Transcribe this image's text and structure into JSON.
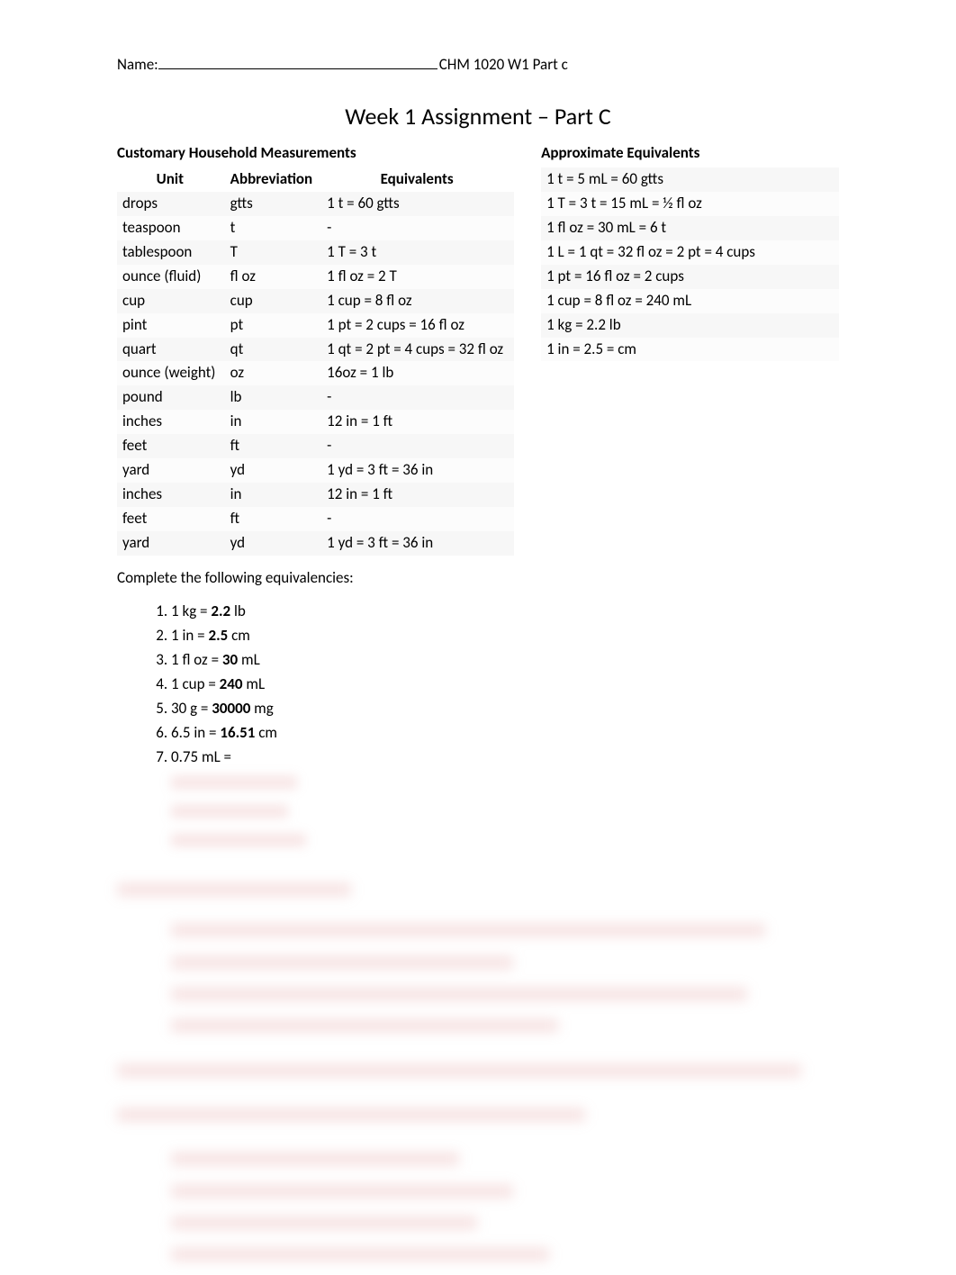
{
  "header": {
    "name_label": "Name:",
    "course": "CHM 1020 W1 Part c"
  },
  "title": "Week 1 Assignment – Part C",
  "left_section_title": "Customary Household Measurements",
  "right_section_title": "Approximate Equivalents",
  "table": {
    "head": {
      "unit": "Unit",
      "abbr": "Abbreviation",
      "equiv": "Equivalents"
    },
    "rows": [
      {
        "unit": "drops",
        "abbr": "gtts",
        "equiv": "1 t = 60 gtts"
      },
      {
        "unit": "teaspoon",
        "abbr": "t",
        "equiv": "-"
      },
      {
        "unit": "tablespoon",
        "abbr": "T",
        "equiv": "1 T = 3 t"
      },
      {
        "unit": "ounce (fluid)",
        "abbr": "fl oz",
        "equiv": "1 fl oz = 2 T"
      },
      {
        "unit": "cup",
        "abbr": "cup",
        "equiv": "1 cup = 8 fl oz"
      },
      {
        "unit": "pint",
        "abbr": "pt",
        "equiv": "1 pt = 2 cups = 16 fl oz"
      },
      {
        "unit": "quart",
        "abbr": "qt",
        "equiv": "1 qt = 2 pt = 4 cups = 32 fl oz"
      },
      {
        "unit": "ounce (weight)",
        "abbr": "oz",
        "equiv": "16oz = 1 lb"
      },
      {
        "unit": "pound",
        "abbr": "lb",
        "equiv": "-"
      },
      {
        "unit": "inches",
        "abbr": "in",
        "equiv": "12 in = 1 ft"
      },
      {
        "unit": "feet",
        "abbr": "ft",
        "equiv": "-"
      },
      {
        "unit": "yard",
        "abbr": "yd",
        "equiv": "1 yd = 3 ft = 36 in"
      },
      {
        "unit": "inches",
        "abbr": "in",
        "equiv": "12 in = 1 ft"
      },
      {
        "unit": "feet",
        "abbr": "ft",
        "equiv": "-"
      },
      {
        "unit": "yard",
        "abbr": "yd",
        "equiv": "1 yd = 3 ft = 36 in"
      }
    ]
  },
  "approx": [
    "1 t = 5 mL = 60 gtts",
    "1 T = 3 t = 15 mL = ½ fl oz",
    "1 fl oz = 30 mL = 6 t",
    "1 L = 1 qt = 32 fl oz = 2 pt = 4 cups",
    "1 pt = 16 fl oz = 2 cups",
    "1 cup = 8 fl oz = 240 mL",
    "1 kg = 2.2 lb",
    "1 in = 2.5 = cm"
  ],
  "complete_line": "Complete the following equivalencies:",
  "equiv_items": [
    {
      "pre": "1 kg = ",
      "ans": "2.2",
      "post": " lb"
    },
    {
      "pre": "1 in = ",
      "ans": "2.5",
      "post": " cm"
    },
    {
      "pre": "1 fl oz = ",
      "ans": "30",
      "post": " mL"
    },
    {
      "pre": "1 cup = ",
      "ans": "240",
      "post": " mL"
    },
    {
      "pre": "30 g = ",
      "ans": "30000",
      "post": " mg"
    },
    {
      "pre": "6.5 in = ",
      "ans": "16.51",
      "post": " cm"
    },
    {
      "pre": "0.75 mL =",
      "ans": "",
      "post": ""
    }
  ]
}
